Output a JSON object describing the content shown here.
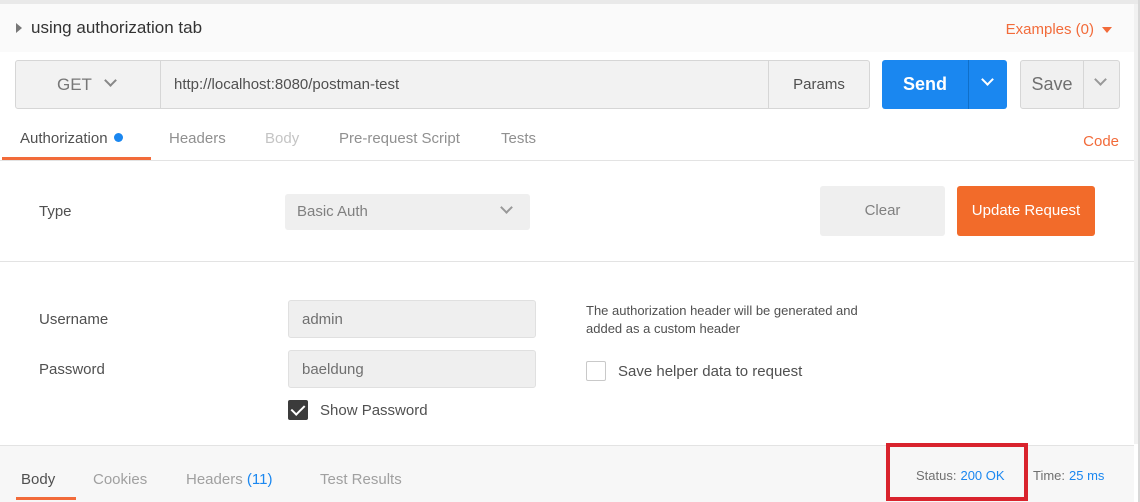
{
  "request": {
    "title": "using authorization tab",
    "examples_label": "Examples (0)",
    "method": "GET",
    "url": "http://localhost:8080/postman-test",
    "params_label": "Params",
    "send_label": "Send",
    "save_label": "Save"
  },
  "request_tabs": {
    "authorization": "Authorization",
    "headers": "Headers",
    "body": "Body",
    "pre_request": "Pre-request Script",
    "tests": "Tests",
    "code": "Code"
  },
  "auth": {
    "type_label": "Type",
    "type_value": "Basic Auth",
    "clear_label": "Clear",
    "update_label": "Update Request",
    "username_label": "Username",
    "username_value": "admin",
    "password_label": "Password",
    "password_value": "baeldung",
    "show_password_label": "Show Password",
    "show_password_checked": true,
    "helper_text_line1": "The authorization header will be generated and",
    "helper_text_line2": "added as a custom header",
    "save_helper_label": "Save helper data to request",
    "save_helper_checked": false
  },
  "response": {
    "tabs": {
      "body": "Body",
      "cookies": "Cookies",
      "headers": "Headers",
      "headers_count": "(11)",
      "test_results": "Test Results"
    },
    "status_label": "Status:",
    "status_value": "200 OK",
    "time_label": "Time:",
    "time_value": "25 ms"
  },
  "colors": {
    "accent_orange": "#f26b3a",
    "send_blue": "#1a87f0",
    "highlight_red": "#d9232d"
  }
}
